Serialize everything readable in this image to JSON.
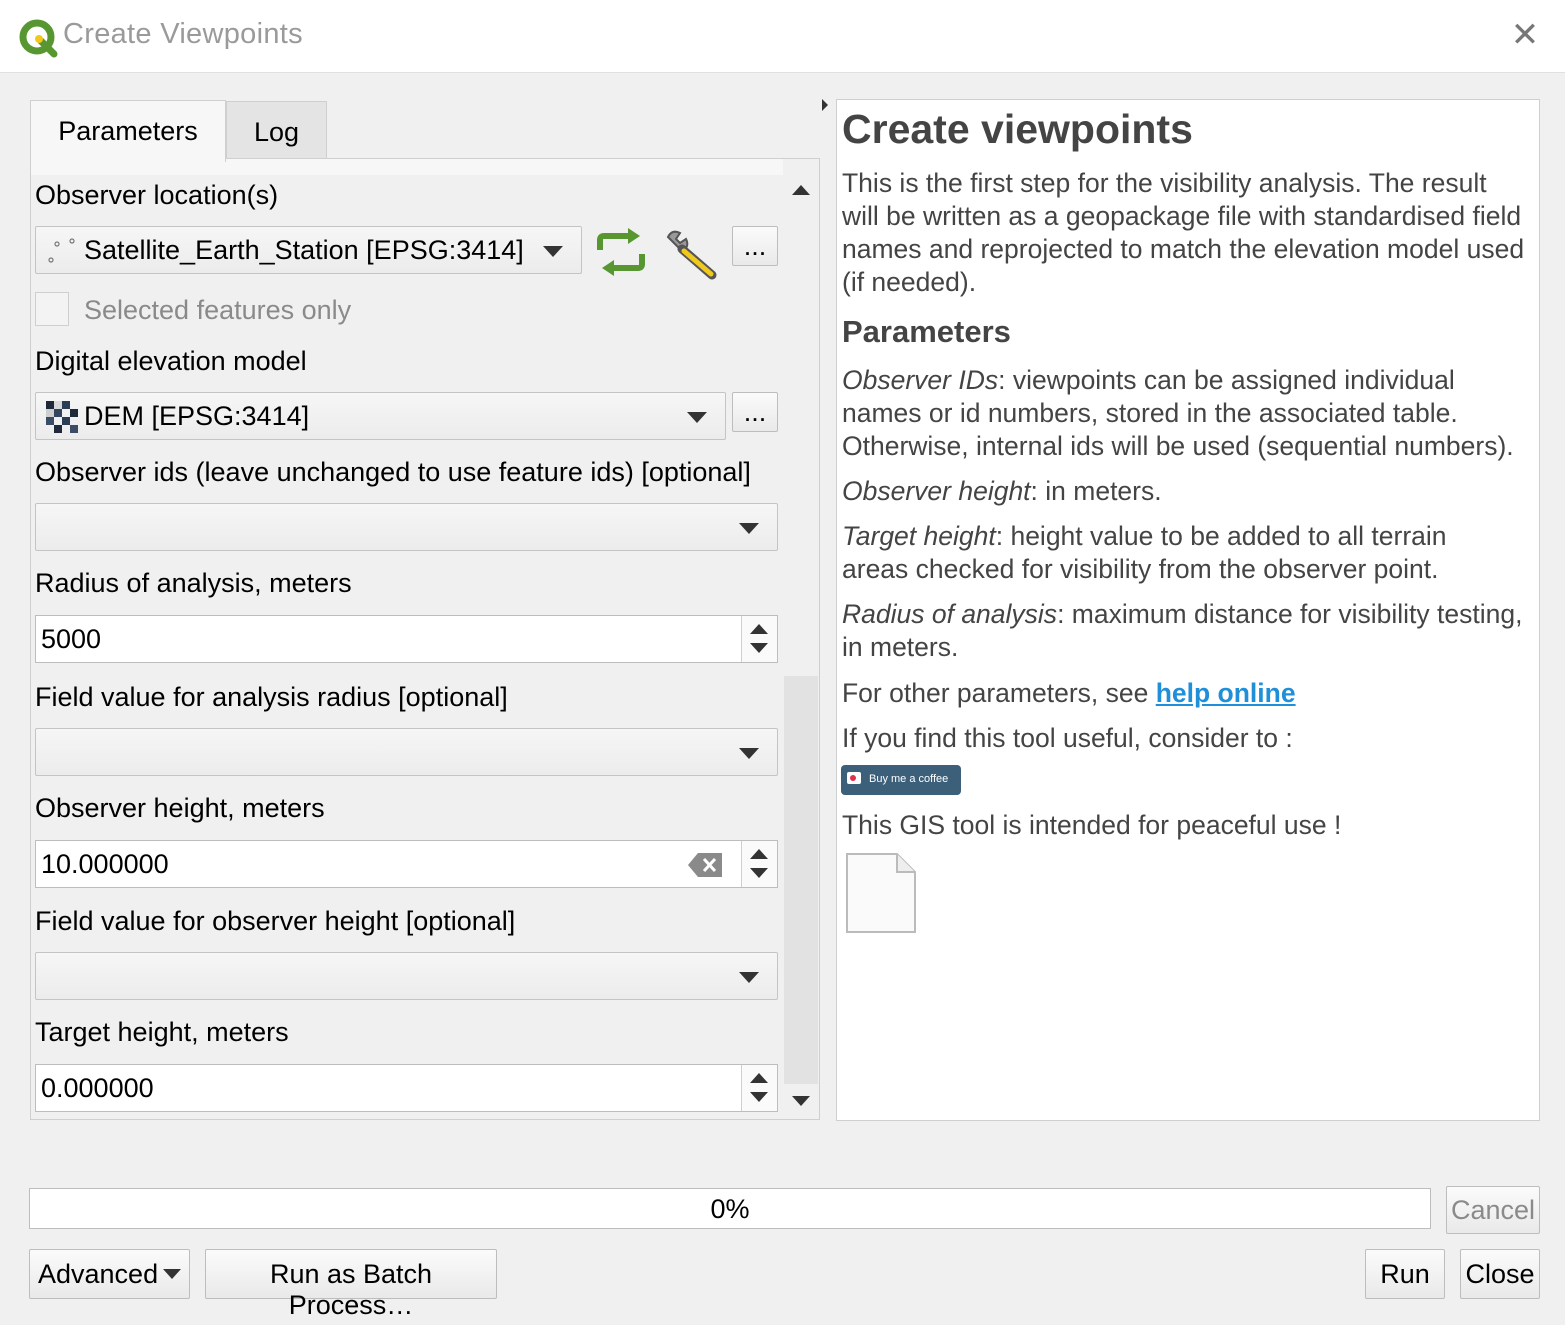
{
  "window": {
    "title": "Create Viewpoints",
    "close_icon": "close-icon"
  },
  "tabs": [
    {
      "label": "Parameters",
      "active": true
    },
    {
      "label": "Log",
      "active": false
    }
  ],
  "params": {
    "observer_location": {
      "label": "Observer location(s)",
      "value": "Satellite_Earth_Station [EPSG:3414]",
      "more_label": "..."
    },
    "selected_only": {
      "label": "Selected features only",
      "checked": false
    },
    "dem": {
      "label": "Digital elevation model",
      "value": "DEM [EPSG:3414]",
      "more_label": "..."
    },
    "observer_ids": {
      "label": "Observer ids (leave unchanged to use feature ids) [optional]",
      "value": ""
    },
    "radius": {
      "label": "Radius of analysis, meters",
      "value": "5000"
    },
    "radius_field": {
      "label": "Field value for analysis radius [optional]",
      "value": ""
    },
    "observer_height": {
      "label": "Observer height, meters",
      "value": "10.000000"
    },
    "observer_height_field": {
      "label": "Field value for observer height [optional]",
      "value": ""
    },
    "target_height": {
      "label": "Target height, meters",
      "value": "0.000000"
    }
  },
  "help": {
    "title": "Create viewpoints",
    "intro": [
      "This is the first step for the visibility analysis. The result",
      "will be written as a geopackage file with standardised field",
      "names and reprojected to match the elevation model used",
      "(if needed)."
    ],
    "params_heading": "Parameters",
    "observer_ids_term": "Observer IDs",
    "observer_ids_text": [
      ": viewpoints can be assigned individual",
      "names or id numbers, stored in the associated table.",
      "Otherwise, internal ids will be used (sequential numbers)."
    ],
    "observer_height_term": "Observer height",
    "observer_height_text": ": in meters.",
    "target_height_term": "Target height",
    "target_height_text": [
      ": height value to be added to all terrain",
      "areas checked for visibility from the observer point."
    ],
    "radius_term": "Radius of analysis",
    "radius_text": [
      ": maximum distance for visibility testing,",
      "in meters."
    ],
    "other_params_text": "For other parameters, see ",
    "help_link": "help online",
    "useful_text": "If you find this tool useful, consider to :",
    "coffee_label": "Buy me a coffee",
    "peaceful_text": "This GIS tool is intended for peaceful use !"
  },
  "progress": {
    "value": 0,
    "text": "0%"
  },
  "buttons": {
    "cancel": "Cancel",
    "advanced": "Advanced",
    "batch": "Run as Batch Process…",
    "run": "Run",
    "close": "Close"
  },
  "colors": {
    "accent_link": "#1f8fd9",
    "qgis_green": "#589632",
    "qgis_yellow": "#f0c81e"
  }
}
